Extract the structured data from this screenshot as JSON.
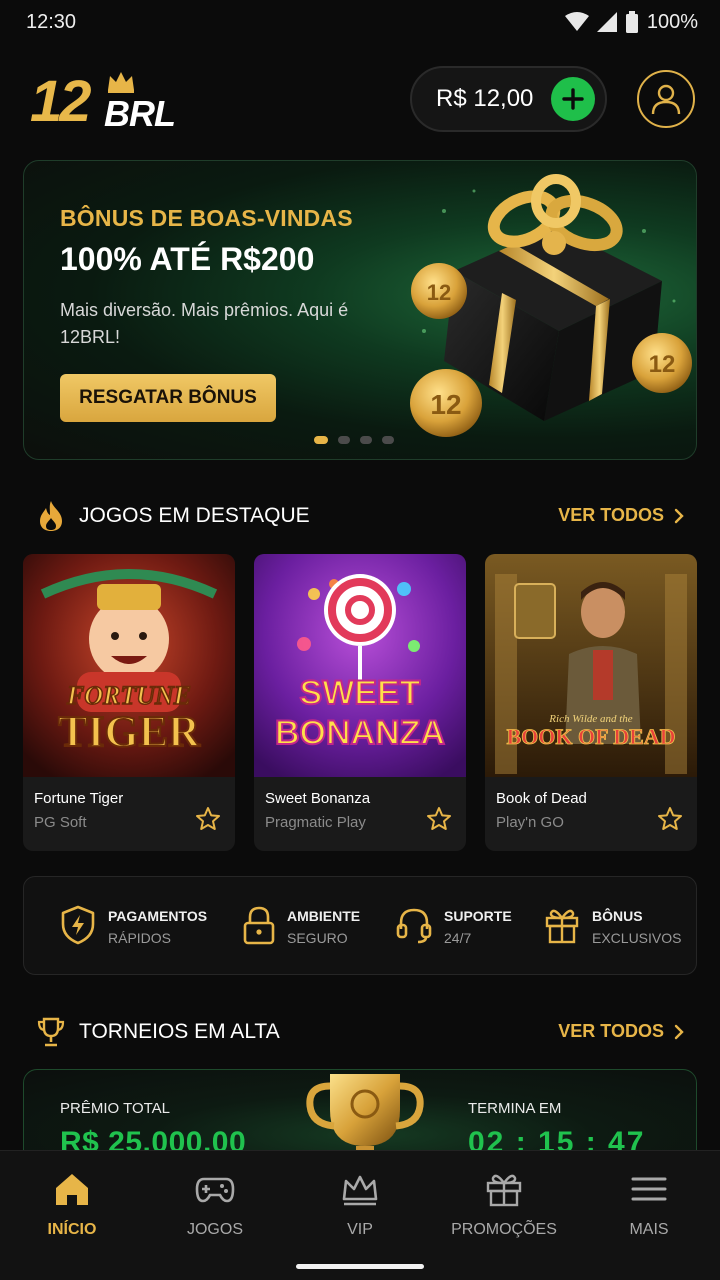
{
  "status_bar": {
    "time": "12:30",
    "battery": "100%"
  },
  "header": {
    "logo_number": "12",
    "logo_text": "BRL",
    "balance": "R$ 12,00",
    "add_icon": "plus-icon",
    "profile_icon": "user-icon"
  },
  "banner": {
    "kicker": "BÔNUS DE BOAS-VINDAS",
    "title": "100% ATÉ R$200",
    "subtitle": "Mais diversão. Mais prêmios. Aqui é 12BRL!",
    "button": "RESGATAR BÔNUS",
    "slides": 4,
    "active_slide": 1,
    "coin_label": "12"
  },
  "featured": {
    "title": "JOGOS EM DESTAQUE",
    "link": "VER TODOS",
    "games": [
      {
        "name": "Fortune Tiger",
        "provider": "PG Soft",
        "art_line1": "FORTUNE",
        "art_line2": "TIGER"
      },
      {
        "name": "Sweet Bonanza",
        "provider": "Pragmatic Play",
        "art_line1": "SWEET",
        "art_line2": "BONANZA"
      },
      {
        "name": "Book of Dead",
        "provider": "Play'n GO",
        "art_line1": "Rich Wilde and the",
        "art_line2": "BOOK OF DEAD"
      }
    ]
  },
  "features": [
    {
      "line1": "PAGAMENTOS",
      "line2": "RÁPIDOS",
      "icon": "shield-bolt-icon"
    },
    {
      "line1": "AMBIENTE",
      "line2": "SEGURO",
      "icon": "lock-icon"
    },
    {
      "line1": "SUPORTE",
      "line2": "24/7",
      "icon": "headset-icon"
    },
    {
      "line1": "BÔNUS",
      "line2": "EXCLUSIVOS",
      "icon": "gift-icon"
    }
  ],
  "tournaments": {
    "title": "TORNEIOS EM ALTA",
    "link": "VER TODOS",
    "prize_label": "PRÊMIO TOTAL",
    "prize_value": "R$ 25.000,00",
    "ends_label": "TERMINA EM",
    "ends_value": "02 : 15 : 47"
  },
  "bottom_nav": [
    {
      "label": "INÍCIO",
      "icon": "home-icon",
      "active": true
    },
    {
      "label": "JOGOS",
      "icon": "gamepad-icon",
      "active": false
    },
    {
      "label": "VIP",
      "icon": "crown-icon",
      "active": false
    },
    {
      "label": "PROMOÇÕES",
      "icon": "gift-icon",
      "active": false
    },
    {
      "label": "MAIS",
      "icon": "menu-icon",
      "active": false
    }
  ],
  "colors": {
    "accent": "#e7b548",
    "green": "#1fbf4a",
    "background": "#0b0b0b"
  }
}
